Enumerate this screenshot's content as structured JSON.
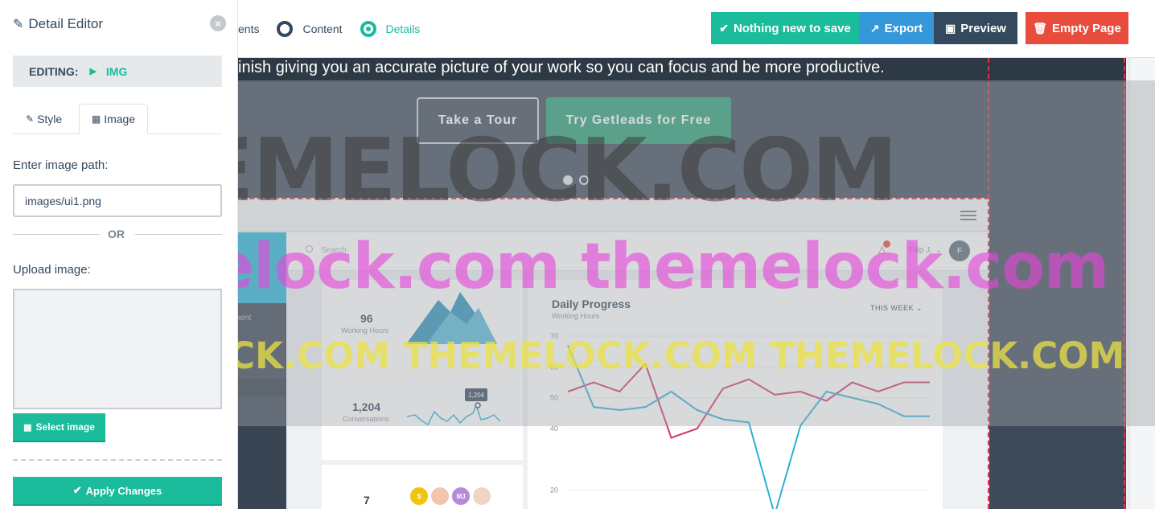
{
  "steps": [
    {
      "label": "ents",
      "active": false
    },
    {
      "label": "Content",
      "active": false
    },
    {
      "label": "Details",
      "active": true
    }
  ],
  "toolbar": {
    "save_label": "Nothing new to save",
    "export_label": "Export",
    "preview_label": "Preview",
    "empty_label": "Empty Page"
  },
  "panel": {
    "title": "Detail Editor",
    "editing_label": "EDITING:",
    "editing_tag": "IMG",
    "tab_style": "Style",
    "tab_image": "Image",
    "path_label": "Enter image path:",
    "path_value": "images/ui1.png",
    "or_label": "OR",
    "upload_label": "Upload image:",
    "select_label": "Select image",
    "apply_label": "Apply Changes"
  },
  "hero": {
    "text": "inish giving you an accurate picture of your work so you can focus and be more productive.",
    "tour_label": "Take a Tour",
    "try_label": "Try Getleads for Free"
  },
  "mock_app": {
    "search_placeholder": "Search",
    "user_name": "Filip J.",
    "avatar_letter": "F",
    "sidebar_item": "ment",
    "stat1_value": "96",
    "stat1_label": "Working Hours",
    "stat2_value": "1,204",
    "stat2_label": "Conversations",
    "tooltip": "1,204",
    "stat3_value": "7",
    "card_title": "Daily Progress",
    "card_sub": "Working Hours",
    "range_label": "THIS WEEK",
    "people": [
      "$",
      "",
      "MJ",
      ""
    ]
  },
  "chart_data": {
    "type": "line",
    "title": "Daily Progress",
    "subtitle": "Working Hours",
    "y_ticks": [
      70,
      60,
      50,
      40,
      20
    ],
    "ylim": [
      10,
      70
    ],
    "x": [
      1,
      2,
      3,
      4,
      5,
      6,
      7,
      8,
      9,
      10,
      11,
      12,
      13,
      14,
      15
    ],
    "series": [
      {
        "color": "#d63864",
        "values": [
          52,
          55,
          52,
          61,
          37,
          40,
          53,
          56,
          51,
          52,
          49,
          55,
          52,
          55,
          55
        ]
      },
      {
        "color": "#2eb0d6",
        "values": [
          67,
          47,
          46,
          47,
          52,
          46,
          43,
          42,
          12,
          41,
          52,
          50,
          48,
          44,
          44
        ]
      }
    ]
  },
  "watermarks": {
    "large": "THEMELOCK.COM",
    "pink": "themelock.com themelock.com",
    "yellow": "THEMELOCK.COM THEMELOCK.COM THEMELOCK.COM"
  },
  "colors": {
    "accent": "#1abc9c",
    "export": "#3498db",
    "preview": "#34495e",
    "danger": "#e74c3c"
  }
}
